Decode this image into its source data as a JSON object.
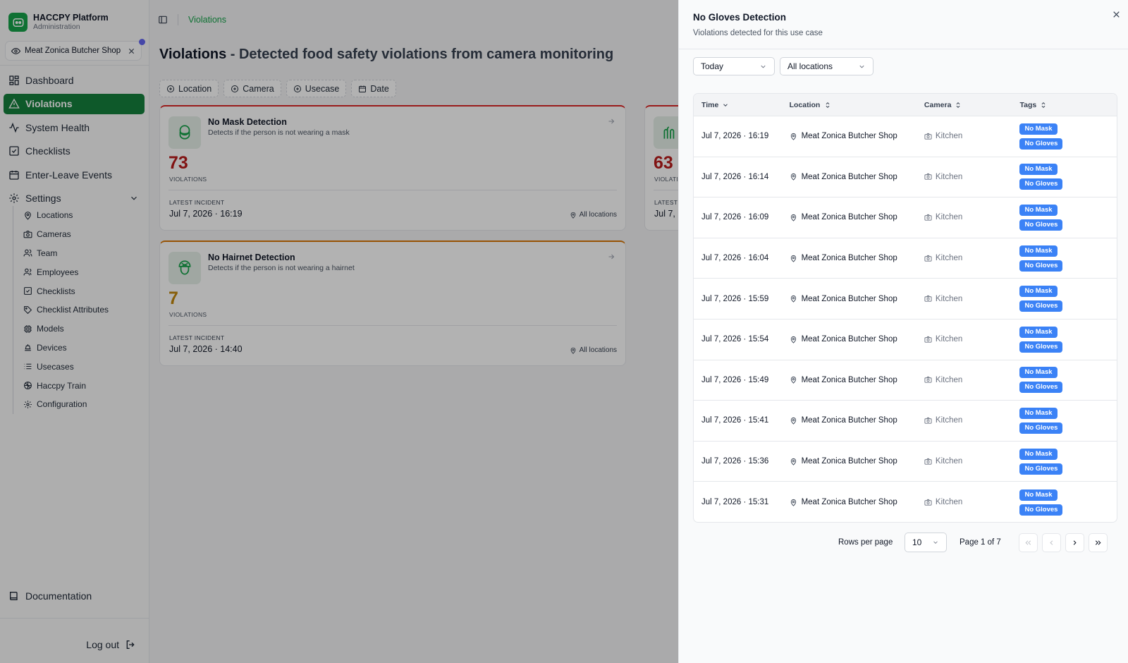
{
  "brand": {
    "title": "HACCPY Platform",
    "subtitle": "Administration"
  },
  "location_chip": {
    "label": "Meat Zonica Butcher Shop"
  },
  "nav": {
    "dashboard": "Dashboard",
    "violations": "Violations",
    "system_health": "System Health",
    "checklists": "Checklists",
    "enter_leave": "Enter-Leave Events",
    "settings": "Settings"
  },
  "subnav": {
    "locations": "Locations",
    "cameras": "Cameras",
    "team": "Team",
    "employees": "Employees",
    "checklists": "Checklists",
    "checklist_attributes": "Checklist Attributes",
    "models": "Models",
    "devices": "Devices",
    "usecases": "Usecases",
    "haccpy_train": "Haccpy Train",
    "configuration": "Configuration"
  },
  "footer": {
    "documentation": "Documentation",
    "logout": "Log out"
  },
  "breadcrumb": {
    "current": "Violations"
  },
  "page": {
    "title": "Violations",
    "subtitle": " - Detected food safety violations from camera monitoring"
  },
  "filters": {
    "location": "Location",
    "camera": "Camera",
    "usecase": "Usecase",
    "date": "Date"
  },
  "cards": [
    {
      "title": "No Mask Detection",
      "description": "Detects if the person is not wearing a mask",
      "count": "73",
      "count_label": "VIOLATIONS",
      "incident_label": "LATEST INCIDENT",
      "incident_time": "Jul 7, 2026 · 16:19",
      "location": "All locations",
      "accent": "#dc2626"
    },
    {
      "title": "No Hairnet Detection",
      "description": "Detects if the person is not wearing a hairnet",
      "count": "7",
      "count_label": "VIOLATIONS",
      "incident_label": "LATEST INCIDENT",
      "incident_time": "Jul 7, 2026 · 14:40",
      "location": "All locations",
      "accent": "#d97706"
    },
    {
      "count": "63",
      "count_label": "VIOLATI",
      "incident_label": "LATEST",
      "incident_time": "Jul 7,",
      "accent": "#dc2626"
    }
  ],
  "drawer": {
    "title": "No Gloves Detection",
    "subtitle": "Violations detected for this use case",
    "date_filter": "Today",
    "location_filter": "All locations",
    "columns": {
      "time": "Time",
      "location": "Location",
      "camera": "Camera",
      "tags": "Tags"
    },
    "rows": [
      {
        "time": "Jul 7, 2026 · 16:19",
        "location": "Meat Zonica Butcher Shop",
        "camera": "Kitchen",
        "tags": [
          "No Mask",
          "No Gloves"
        ]
      },
      {
        "time": "Jul 7, 2026 · 16:14",
        "location": "Meat Zonica Butcher Shop",
        "camera": "Kitchen",
        "tags": [
          "No Mask",
          "No Gloves"
        ]
      },
      {
        "time": "Jul 7, 2026 · 16:09",
        "location": "Meat Zonica Butcher Shop",
        "camera": "Kitchen",
        "tags": [
          "No Mask",
          "No Gloves"
        ]
      },
      {
        "time": "Jul 7, 2026 · 16:04",
        "location": "Meat Zonica Butcher Shop",
        "camera": "Kitchen",
        "tags": [
          "No Mask",
          "No Gloves"
        ]
      },
      {
        "time": "Jul 7, 2026 · 15:59",
        "location": "Meat Zonica Butcher Shop",
        "camera": "Kitchen",
        "tags": [
          "No Mask",
          "No Gloves"
        ]
      },
      {
        "time": "Jul 7, 2026 · 15:54",
        "location": "Meat Zonica Butcher Shop",
        "camera": "Kitchen",
        "tags": [
          "No Mask",
          "No Gloves"
        ]
      },
      {
        "time": "Jul 7, 2026 · 15:49",
        "location": "Meat Zonica Butcher Shop",
        "camera": "Kitchen",
        "tags": [
          "No Mask",
          "No Gloves"
        ]
      },
      {
        "time": "Jul 7, 2026 · 15:41",
        "location": "Meat Zonica Butcher Shop",
        "camera": "Kitchen",
        "tags": [
          "No Mask",
          "No Gloves"
        ]
      },
      {
        "time": "Jul 7, 2026 · 15:36",
        "location": "Meat Zonica Butcher Shop",
        "camera": "Kitchen",
        "tags": [
          "No Mask",
          "No Gloves"
        ]
      },
      {
        "time": "Jul 7, 2026 · 15:31",
        "location": "Meat Zonica Butcher Shop",
        "camera": "Kitchen",
        "tags": [
          "No Mask",
          "No Gloves"
        ]
      }
    ],
    "pagination": {
      "rows_per_page_label": "Rows per page",
      "rows_per_page": "10",
      "page_text": "Page 1 of 7"
    }
  },
  "colors": {
    "primary": "#15803d",
    "tag": "#3b82f6",
    "danger": "#b91c1c",
    "warning": "#c2870c",
    "badge_dot": "#6366f1"
  }
}
